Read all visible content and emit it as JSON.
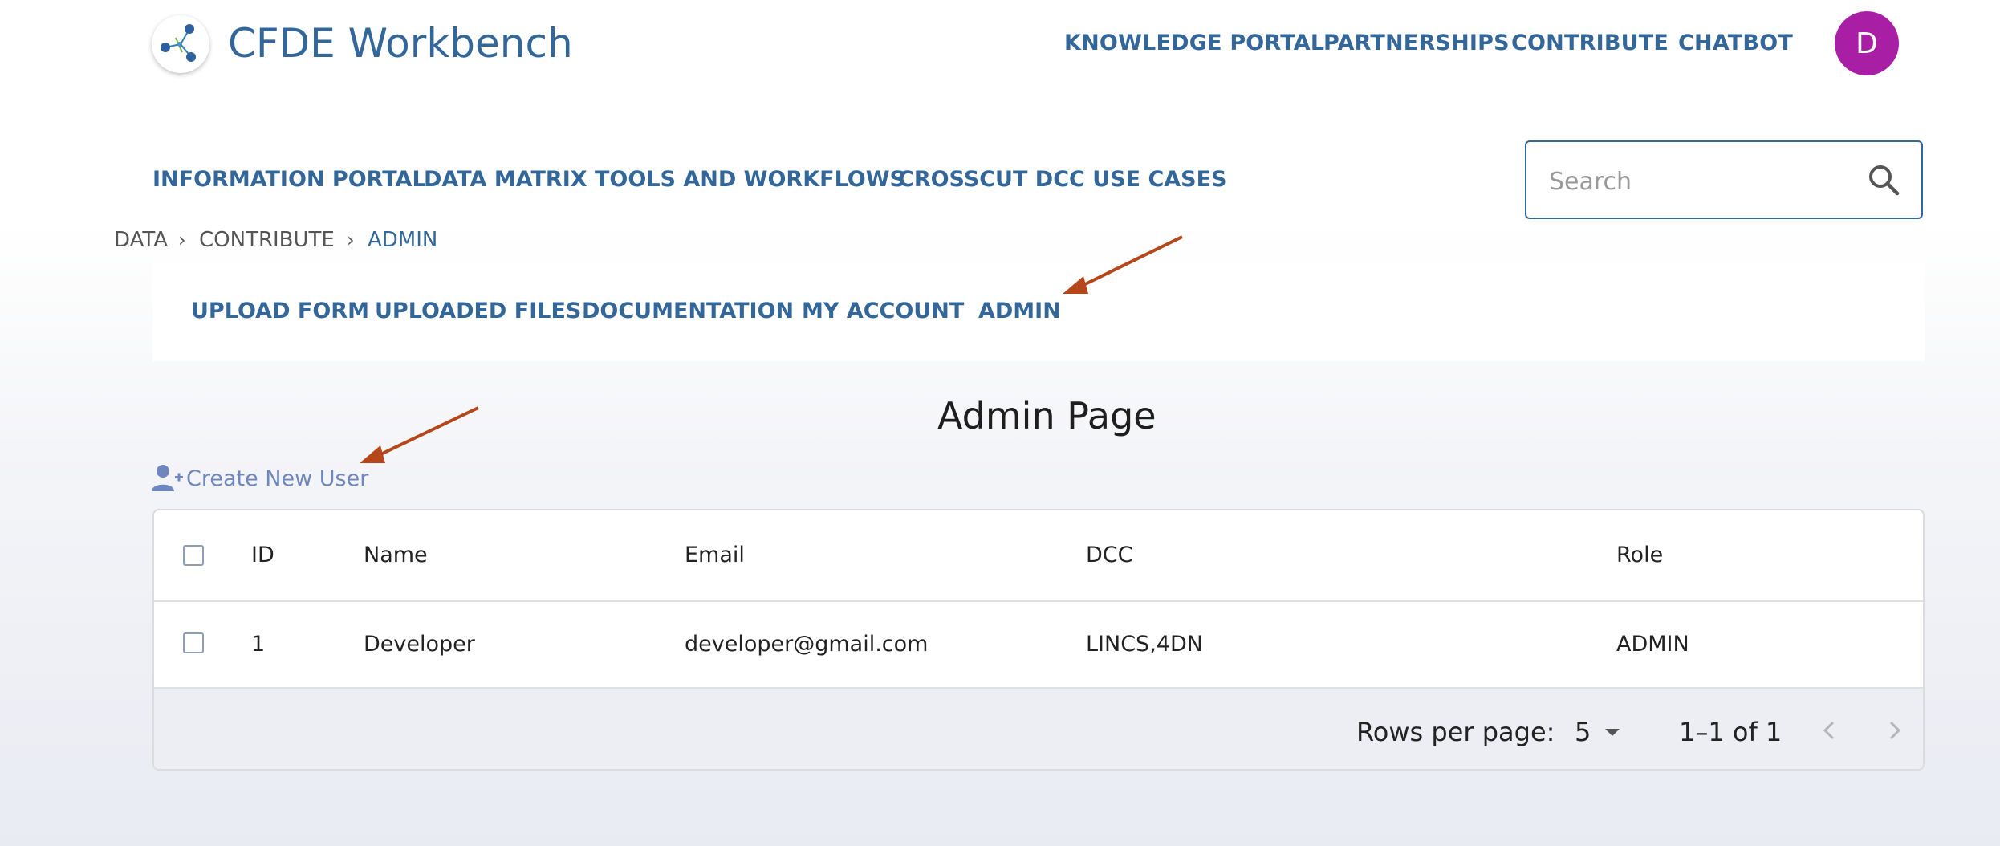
{
  "header": {
    "app_title": "CFDE Workbench",
    "logo_icon": "molecule-logo-icon",
    "nav": [
      "KNOWLEDGE PORTAL",
      "PARTNERSHIPS",
      "CONTRIBUTE",
      "CHATBOT"
    ],
    "avatar_initial": "D",
    "avatar_color": "#a81fa6"
  },
  "secondary_nav": [
    "INFORMATION PORTAL",
    "DATA MATRIX",
    "TOOLS AND WORKFLOWS",
    "CROSSCUT DCC USE CASES"
  ],
  "search": {
    "placeholder": "Search",
    "value": ""
  },
  "breadcrumb": [
    "DATA",
    "CONTRIBUTE",
    "ADMIN"
  ],
  "contribute_nav": [
    "UPLOAD FORM",
    "UPLOADED FILES",
    "DOCUMENTATION",
    "MY ACCOUNT",
    "ADMIN"
  ],
  "page_title": "Admin Page",
  "create_user_label": "Create New User",
  "table": {
    "columns": [
      "ID",
      "Name",
      "Email",
      "DCC",
      "Role"
    ],
    "rows": [
      {
        "id": "1",
        "name": "Developer",
        "email": "developer@gmail.com",
        "dcc": "LINCS,4DN",
        "role": "ADMIN"
      }
    ],
    "footer": {
      "rows_per_page_label": "Rows per page:",
      "rows_per_page_value": "5",
      "range_text": "1–1 of 1"
    }
  },
  "colors": {
    "brand_blue": "#336699",
    "link_muted": "#6f86bf",
    "annotation_arrow": "#b5471b"
  }
}
